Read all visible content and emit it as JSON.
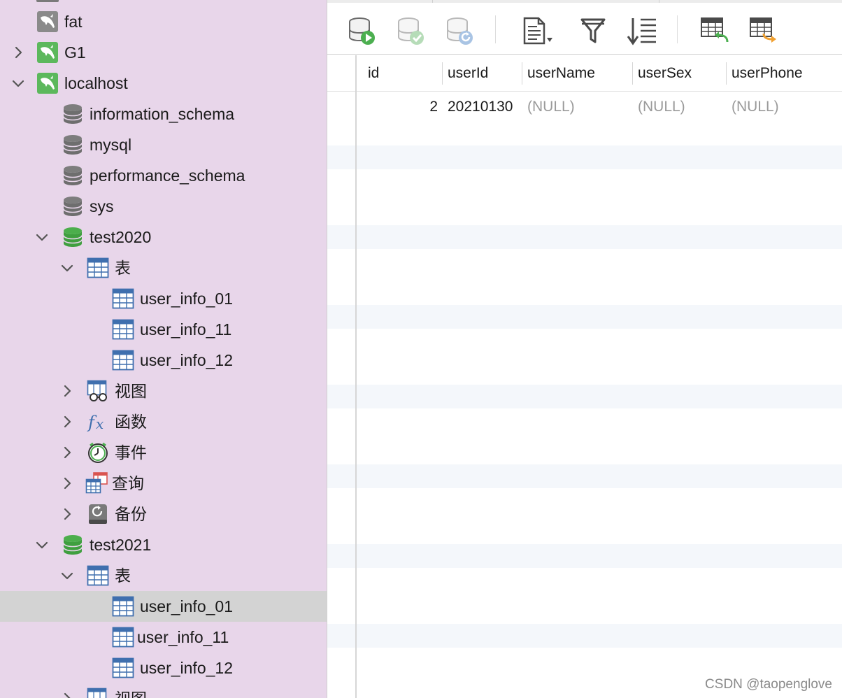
{
  "sidebar": {
    "tree": [
      {
        "label": "fat",
        "icon": "mysql-connection-icon",
        "level": 0,
        "chevron": "none"
      },
      {
        "label": "G1",
        "icon": "mysql-connection-icon",
        "level": 0,
        "chevron": "right"
      },
      {
        "label": "localhost",
        "icon": "mysql-connection-icon",
        "level": 0,
        "chevron": "down"
      },
      {
        "label": "information_schema",
        "icon": "database-gray-icon",
        "level": 1,
        "chevron": "none"
      },
      {
        "label": "mysql",
        "icon": "database-gray-icon",
        "level": 1,
        "chevron": "none"
      },
      {
        "label": "performance_schema",
        "icon": "database-gray-icon",
        "level": 1,
        "chevron": "none"
      },
      {
        "label": "sys",
        "icon": "database-gray-icon",
        "level": 1,
        "chevron": "none"
      },
      {
        "label": "test2020",
        "icon": "database-green-icon",
        "level": 1,
        "chevron": "down"
      },
      {
        "label": "表",
        "icon": "table-folder-icon",
        "level": 2,
        "chevron": "down"
      },
      {
        "label": "user_info_01",
        "icon": "table-icon",
        "level": 3,
        "chevron": "none"
      },
      {
        "label": "user_info_11",
        "icon": "table-icon",
        "level": 3,
        "chevron": "none"
      },
      {
        "label": "user_info_12",
        "icon": "table-icon",
        "level": 3,
        "chevron": "none"
      },
      {
        "label": "视图",
        "icon": "view-icon",
        "level": 2,
        "chevron": "right"
      },
      {
        "label": "函数",
        "icon": "function-icon",
        "level": 2,
        "chevron": "right"
      },
      {
        "label": "事件",
        "icon": "event-clock-icon",
        "level": 2,
        "chevron": "right"
      },
      {
        "label": "查询",
        "icon": "query-icon",
        "level": 2,
        "chevron": "right"
      },
      {
        "label": "备份",
        "icon": "backup-icon",
        "level": 2,
        "chevron": "right"
      },
      {
        "label": "test2021",
        "icon": "database-green-icon",
        "level": 1,
        "chevron": "down"
      },
      {
        "label": "表",
        "icon": "table-folder-icon",
        "level": 2,
        "chevron": "down"
      },
      {
        "label": "user_info_01",
        "icon": "table-icon",
        "level": 3,
        "chevron": "none",
        "selected": true
      },
      {
        "label": "user_info_11",
        "icon": "table-icon",
        "level": 3,
        "chevron": "none"
      },
      {
        "label": "user_info_12",
        "icon": "table-icon",
        "level": 3,
        "chevron": "none"
      },
      {
        "label": "视图",
        "icon": "view-icon",
        "level": 2,
        "chevron": "right"
      }
    ]
  },
  "toolbar": {
    "buttons": [
      {
        "name": "begin-transaction-button",
        "icon": "db-play-icon"
      },
      {
        "name": "commit-button",
        "icon": "db-check-icon"
      },
      {
        "name": "rollback-button",
        "icon": "db-refresh-icon"
      },
      {
        "name": "text-menu-button",
        "icon": "document-dropdown-icon"
      },
      {
        "name": "filter-button",
        "icon": "funnel-icon"
      },
      {
        "name": "sort-button",
        "icon": "sort-icon"
      },
      {
        "name": "import-button",
        "icon": "table-import-icon"
      },
      {
        "name": "export-button",
        "icon": "table-export-icon"
      }
    ]
  },
  "grid": {
    "columns": [
      "id",
      "userId",
      "userName",
      "userSex",
      "userPhone"
    ],
    "rows": [
      [
        "2",
        "20210130",
        "(NULL)",
        "(NULL)",
        "(NULL)"
      ]
    ]
  },
  "watermark": "CSDN @taopenglove"
}
